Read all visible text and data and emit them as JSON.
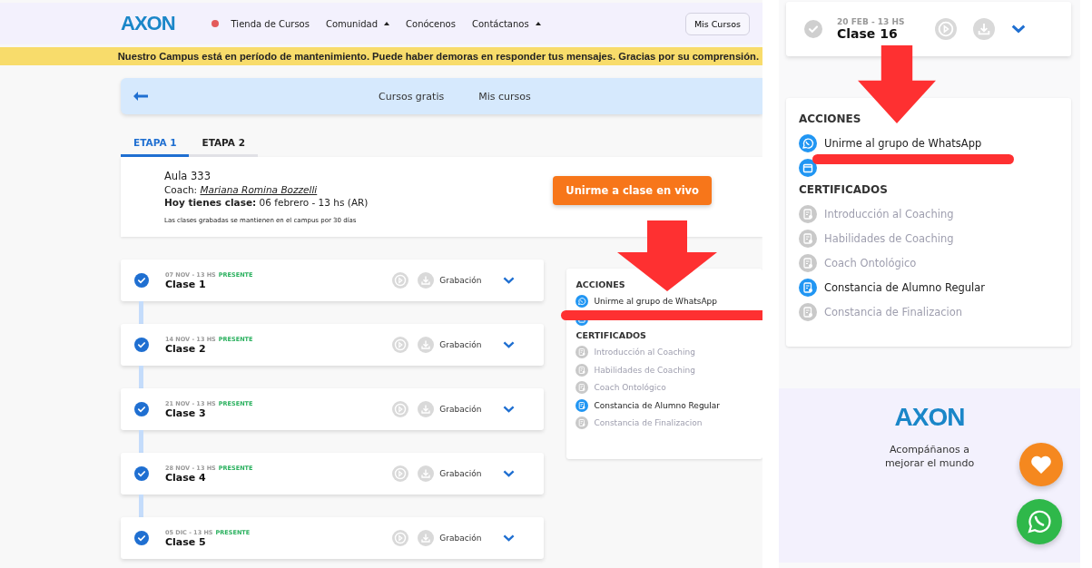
{
  "left_view": {
    "header": {
      "logo": "AXON",
      "nav": [
        {
          "label": "Tienda de Cursos",
          "has_dot": true,
          "has_caret": false
        },
        {
          "label": "Comunidad",
          "has_dot": false,
          "has_caret": true
        },
        {
          "label": "Conócenos",
          "has_dot": false,
          "has_caret": false
        },
        {
          "label": "Contáctanos",
          "has_dot": false,
          "has_caret": true
        }
      ],
      "button": "Mis Cursos"
    },
    "banner": "Nuestro Campus está en período de mantenimiento. Puede haber demoras en responder tus mensajes. Gracias por su comprensión.",
    "subnav": [
      "Cursos gratis",
      "Mis cursos"
    ],
    "tabs": [
      {
        "label": "ETAPA 1",
        "selected": true
      },
      {
        "label": "ETAPA 2",
        "selected": false
      }
    ],
    "info": {
      "aula": "Aula 333",
      "coach_label": "Coach:",
      "coach_name": "Mariana Romina Bozzelli",
      "today_label": "Hoy tienes clase:",
      "today_value": "06 febrero - 13 hs (AR)",
      "note": "Las clases grabadas se mantienen en el campus por 30 días",
      "join_button": "Unirme a clase en vivo"
    },
    "classes": [
      {
        "date": "07 NOV - 13 HS",
        "status": "PRESENTE",
        "title": "Clase 1",
        "completed": true,
        "recording": "Grabación"
      },
      {
        "date": "14 NOV - 13 HS",
        "status": "PRESENTE",
        "title": "Clase 2",
        "completed": true,
        "recording": "Grabación"
      },
      {
        "date": "21 NOV - 13 HS",
        "status": "PRESENTE",
        "title": "Clase 3",
        "completed": true,
        "recording": "Grabación"
      },
      {
        "date": "28 NOV - 13 HS",
        "status": "PRESENTE",
        "title": "Clase 4",
        "completed": true,
        "recording": "Grabación"
      },
      {
        "date": "05 DIC - 13 HS",
        "status": "PRESENTE",
        "title": "Clase 5",
        "completed": true,
        "recording": "Grabación"
      }
    ],
    "panel": {
      "actions_title": "ACCIONES",
      "actions": [
        {
          "kind": "whatsapp",
          "label": "Unirme al grupo de WhatsApp"
        },
        {
          "kind": "calendar"
        }
      ],
      "certificates_title": "CERTIFICADOS",
      "certificates": [
        {
          "label": "Introducción al Coaching",
          "available": false
        },
        {
          "label": "Habilidades de Coaching",
          "available": false
        },
        {
          "label": "Coach Ontológico",
          "available": false
        },
        {
          "label": "Constancia de Alumno Regular",
          "available": true
        },
        {
          "label": "Constancia de Finalizacion",
          "available": false
        }
      ]
    }
  },
  "right_view": {
    "class": {
      "date": "20 FEB - 13 HS",
      "title": "Clase 16",
      "completed": false
    },
    "panel": {
      "actions_title": "ACCIONES",
      "actions": [
        {
          "kind": "whatsapp",
          "label": "Unirme al grupo de WhatsApp"
        },
        {
          "kind": "calendar"
        }
      ],
      "certificates_title": "CERTIFICADOS",
      "certificates": [
        {
          "label": "Introducción al Coaching",
          "available": false
        },
        {
          "label": "Habilidades de Coaching",
          "available": false
        },
        {
          "label": "Coach Ontológico",
          "available": false
        },
        {
          "label": "Constancia de Alumno Regular",
          "available": true
        },
        {
          "label": "Constancia de Finalizacion",
          "available": false
        }
      ]
    },
    "footer": {
      "logo": "AXON",
      "tagline": "Acompáñanos a mejorar el mundo"
    }
  }
}
